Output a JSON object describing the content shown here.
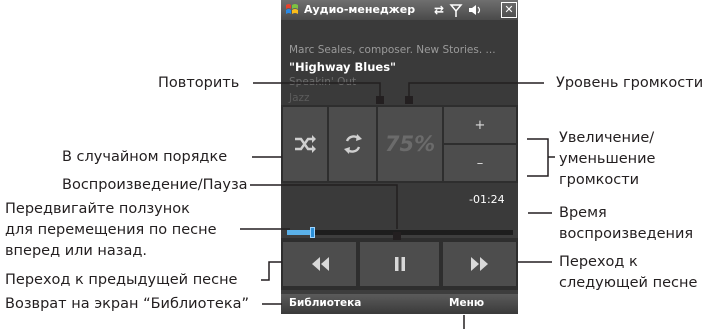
{
  "window": {
    "title": "Аудио-менеджер",
    "status_icons": [
      "start-flag-icon",
      "sync-arrows-icon",
      "signal-icon",
      "speaker-icon",
      "close-icon"
    ],
    "close_label": "✕"
  },
  "now_playing": {
    "artist_line": "Marc Seales, composer. New Stories. ...",
    "song_title": "\"Highway Blues\"",
    "album": "Speakin' Out",
    "genre": "Jazz"
  },
  "controls": {
    "shuffle_icon": "shuffle-icon",
    "repeat_icon": "repeat-icon",
    "volume_level": "75%",
    "volume_up_label": "+",
    "volume_down_label": "–"
  },
  "playback": {
    "time_remaining": "-01:24",
    "progress_fraction": 0.11
  },
  "navigation": {
    "previous_icon": "rewind-icon",
    "play_pause_icon": "pause-icon",
    "next_icon": "fast-forward-icon"
  },
  "softkeys": {
    "left": "Библиотека",
    "right": "Меню"
  },
  "callouts": {
    "repeat": "Повторить",
    "volume_level": "Уровень громкости",
    "shuffle": "В случайном порядке",
    "volume_change_1": "Увеличение/",
    "volume_change_2": "уменьшение",
    "volume_change_3": "громкости",
    "play_pause": "Воспроизведение/Пауза",
    "slider_1": "Передвигайте ползунок",
    "slider_2": "для перемещения по песне",
    "slider_3": "вперед или назад.",
    "time_1": "Время",
    "time_2": "воспроизведения",
    "previous": "Переход к предыдущей песне",
    "next_1": "Переход к",
    "next_2": "следующей песне",
    "library": "Возврат на экран “Библиотека”"
  },
  "colors": {
    "accent_progress": "#5ab0e8",
    "screen_bg": "#3d3d3d",
    "button_bg": "#4d4d4d"
  }
}
